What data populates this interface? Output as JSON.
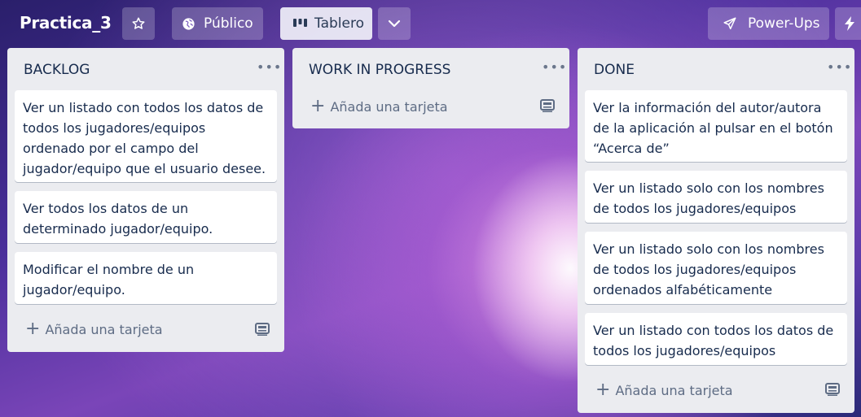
{
  "header": {
    "board_title": "Practica_3",
    "visibility_label": "Público",
    "view_label": "Tablero",
    "powerups_label": "Power-Ups"
  },
  "lists": [
    {
      "title": "BACKLOG",
      "cards": [
        "Ver un listado con todos los datos de todos los jugadores/equipos ordenado por el campo del jugador/equipo que el usuario desee.",
        "Ver todos los datos de un determinado jugador/equipo.",
        "Modificar el nombre de un jugador/equipo."
      ],
      "add_card_label": "Añada una tarjeta"
    },
    {
      "title": "WORK IN PROGRESS",
      "cards": [],
      "add_card_label": "Añada una tarjeta"
    },
    {
      "title": "DONE",
      "cards": [
        "Ver la información del autor/autora de la aplicación al pulsar en el botón “Acerca de”",
        "Ver un listado solo con los nombres de todos los jugadores/equipos",
        "Ver un listado solo con los nombres de todos los jugadores/equipos ordenados alfabéticamente",
        "Ver un listado con todos los datos de todos los jugadores/equipos"
      ],
      "add_card_label": "Añada una tarjeta"
    }
  ],
  "icons": {
    "star": "star-icon",
    "globe": "globe-icon",
    "board": "board-icon",
    "chevron": "chevron-down-icon",
    "rocket": "rocket-icon",
    "bolt": "bolt-icon",
    "menu": "ellipsis-icon",
    "template": "card-template-icon"
  }
}
